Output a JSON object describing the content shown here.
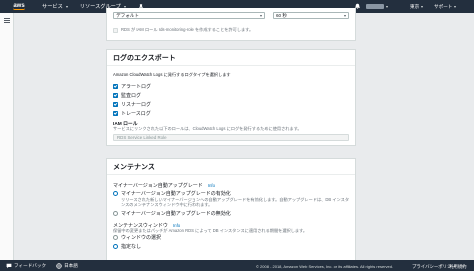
{
  "nav": {
    "logo": "aws",
    "services": "サービス",
    "resource_groups": "リソースグループ",
    "region": "東京",
    "support": "サポート"
  },
  "top": {
    "select_default": "デフォルト",
    "select_interval": "60 秒",
    "monitoring_role_note": "RDS が IAM ロール rds-monitoring-role を作成することを許可します。"
  },
  "log_export": {
    "title": "ログのエクスポート",
    "desc": "Amazon CloudWatch Logs に発行するログタイプを選択します",
    "logs": [
      {
        "label": "アラートログ",
        "checked": true
      },
      {
        "label": "監査ログ",
        "checked": true
      },
      {
        "label": "リスナーログ",
        "checked": true
      },
      {
        "label": "トレースログ",
        "checked": true
      }
    ],
    "iam_label": "IAM ロール",
    "iam_desc": "サービスにリンクされた以下のロールは、CloudWatch Logs にログを発行するために使用されます。",
    "iam_value": "RDS Service Linked Role"
  },
  "maintenance": {
    "title": "メンテナンス",
    "upgrade_label": "マイナーバージョン自動アップグレード",
    "info": "Info",
    "enable_label": "マイナーバージョン自動アップグレードの有効化",
    "enable_desc": "リリースされた新しいマイナーバージョンへの自動アップグレードを有効化します。自動アップグレードは、DB インスタンスのメンテナンスウィンドウ中に行われます。",
    "disable_label": "マイナーバージョン自動アップグレードの無効化",
    "window_label": "メンテナンスウィンドウ",
    "window_desc": "保留中の変更またはパッチが Amazon RDS によって DB インスタンスに適用される期間を選択します。",
    "window_select": "ウィンドウの選択",
    "no_pref": "指定なし"
  },
  "footer": {
    "feedback": "フィードバック",
    "language": "日本語",
    "copyright": "© 2008 - 2018, Amazon Web Services, Inc. or its affiliates. All rights reserved.",
    "privacy": "プライバシーポリシー",
    "terms": "利用規約"
  },
  "colors": {
    "nav_bg": "#232f3e",
    "accent": "#0073bb",
    "aws_orange": "#ff9900"
  }
}
